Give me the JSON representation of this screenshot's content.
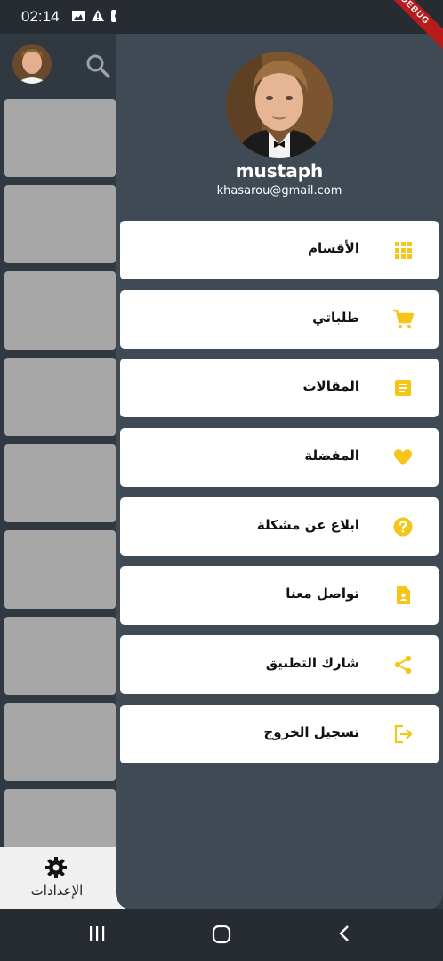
{
  "status_bar": {
    "time": "02:14",
    "icons": [
      "image-icon",
      "warning-icon",
      "notification-icon",
      "dot-icon",
      "location-icon",
      "wifi-icon",
      "signal-icon",
      "battery-icon"
    ]
  },
  "background_screen": {
    "settings_label": "الإعدادات",
    "tile_count": 9
  },
  "drawer": {
    "user_name": "mustaph",
    "user_email": "khasarou@gmail.com",
    "items": [
      {
        "label": "الأقسام",
        "icon": "apps-grid-icon"
      },
      {
        "label": "طلباتي",
        "icon": "shopping-cart-icon"
      },
      {
        "label": "المقالات",
        "icon": "article-icon"
      },
      {
        "label": "المفضلة",
        "icon": "heart-icon"
      },
      {
        "label": "ابلاغ عن مشكلة",
        "icon": "help-icon"
      },
      {
        "label": "تواصل معنا",
        "icon": "contact-icon"
      },
      {
        "label": "شارك التطبيق",
        "icon": "share-icon"
      },
      {
        "label": "تسجيل الخروج",
        "icon": "logout-icon"
      }
    ]
  },
  "debug_banner": "DEBUG",
  "colors": {
    "accent": "#f5c518",
    "drawer_bg": "#3f4a55",
    "page_bg": "#303841",
    "tile_bg": "#a7a7a7"
  }
}
